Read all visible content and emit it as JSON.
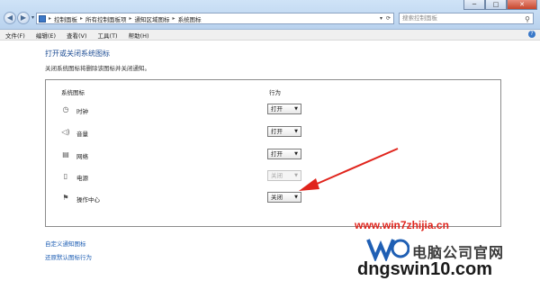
{
  "window": {
    "breadcrumb": [
      "控制面板",
      "所有控制面板项",
      "通知区域图标",
      "系统图标"
    ],
    "search_placeholder": "搜索控制面板",
    "controls": {
      "minimize": "─",
      "maximize": "□",
      "close": "✕"
    }
  },
  "menu": [
    "文件(F)",
    "编辑(E)",
    "查看(V)",
    "工具(T)",
    "帮助(H)"
  ],
  "page": {
    "heading": "打开或关闭系统图标",
    "description": "关闭系统图标将删除该图标并关闭通知。",
    "columns": {
      "icon": "系统图标",
      "behavior": "行为"
    },
    "rows": [
      {
        "icon": "clock-icon",
        "name": "时钟",
        "value": "打开",
        "enabled": true
      },
      {
        "icon": "volume-icon",
        "name": "音量",
        "value": "打开",
        "enabled": true
      },
      {
        "icon": "network-icon",
        "name": "网络",
        "value": "打开",
        "enabled": true
      },
      {
        "icon": "power-icon",
        "name": "电源",
        "value": "关闭",
        "enabled": false
      },
      {
        "icon": "action-center-icon",
        "name": "操作中心",
        "value": "关闭",
        "enabled": true
      }
    ],
    "links": {
      "customize": "自定义通知图标",
      "restore": "还原默认图标行为"
    }
  },
  "annotation": {
    "color": "#e0241c"
  },
  "watermark": {
    "url": "www.win7zhijia.cn",
    "brand": "电脑公司官网",
    "domain": "dngswin10.com"
  }
}
